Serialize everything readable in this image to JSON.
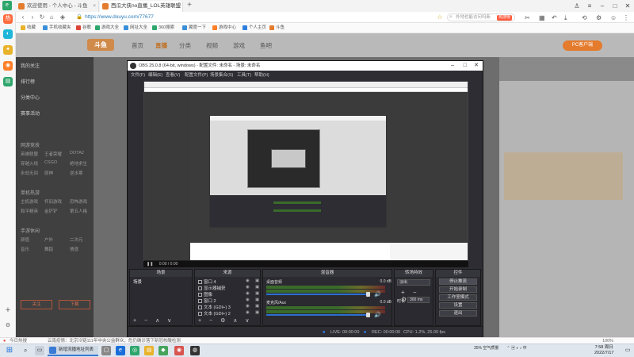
{
  "browser": {
    "tabs": [
      {
        "label": "欢迎使用 - 个人中心 - 斗鱼",
        "active": false
      },
      {
        "label": "西瓜大侠no直播_LOL英雄联盟",
        "active": true
      }
    ],
    "url": "https://www.douyu.com/77677",
    "search_placeholder": "外地也能访问吗新",
    "search_badge": "热搜榜",
    "bookmarks": [
      "收藏",
      "手机收藏夹",
      "谷歌",
      "游戏大全",
      "网址大全",
      "360搜索",
      "翼度一下",
      "游戏中心",
      "个人主页",
      "斗鱼"
    ]
  },
  "douyu": {
    "logo": "斗鱼",
    "nav": [
      "首页",
      "直播",
      "分类",
      "视频",
      "游戏",
      "鱼吧"
    ],
    "client_button": "PC客户端",
    "left_menu": [
      "我的关注",
      "排行榜",
      "分类中心",
      "赛事活动"
    ],
    "left_section_1": "网游竞技",
    "left_section_2": "单机热游",
    "left_section_3": "手游休闲",
    "left_rows": [
      [
        "英雄联盟",
        "王者荣耀",
        "DOTA2"
      ],
      [
        "穿越火线",
        "CSGO",
        "绝地求生"
      ],
      [
        "永劫无间",
        "原神",
        "逆水寒"
      ],
      [
        "主机游戏",
        "怀旧游戏",
        "恐怖游戏"
      ],
      [
        "和平精英",
        "金铲铲",
        "第五人格"
      ],
      [
        "颜值",
        "户外",
        "二次元"
      ],
      [
        "音乐",
        "舞蹈",
        "情感"
      ]
    ],
    "follow_button": "关注",
    "download_button": "下载"
  },
  "obs": {
    "title": "OBS 25.0.8 (64-bit, windows) - 配置文件: 未命名 - 场景: 未命名",
    "menu": [
      "文件(F)",
      "编辑(E)",
      "查看(V)",
      "配置文件(P)",
      "场景集合(S)",
      "工具(T)",
      "帮助(H)"
    ],
    "docks": {
      "scenes": "场景",
      "sources": "来源",
      "mixer": "混音器",
      "transitions": "转场特效",
      "controls": "控件"
    },
    "scene_name": "场景",
    "sources": [
      "窗口 4",
      "显示器捕获",
      "图像",
      "窗口 2",
      "文本 (GDI+) 3",
      "文本 (GDI+) 2"
    ],
    "mixer": [
      {
        "name": "桌面音频",
        "db": "0.0 dB"
      },
      {
        "name": "麦克风/Aux",
        "db": "0.0 dB"
      }
    ],
    "transition_select": "淡出",
    "duration_label": "时长",
    "duration_value": "300 ms",
    "controls": [
      "停止推流",
      "开始录制",
      "工作室模式",
      "设置",
      "退出"
    ],
    "status": {
      "live": "LIVE: 00:00:00",
      "rec": "REC: 00:00:00",
      "cpu": "CPU: 1.2%, 25.00 fps"
    },
    "preview_status": "0:00 / 0:00"
  },
  "statusbar": {
    "left": "今日热搜",
    "news": "云南疫情：北京冷链111年中央公益群众，危仍确诊落下新冠核酸检测",
    "zoom": "100%"
  },
  "taskbar": {
    "app_label": "新增流播地址列表",
    "tray": "35%  空气质量",
    "time": "7:58 周日",
    "date": "2022/7/17"
  },
  "colors": {
    "douyu_orange": "#e47b2d",
    "obs_dark": "#2d2d33",
    "taskbar": "#dfe6ee"
  }
}
